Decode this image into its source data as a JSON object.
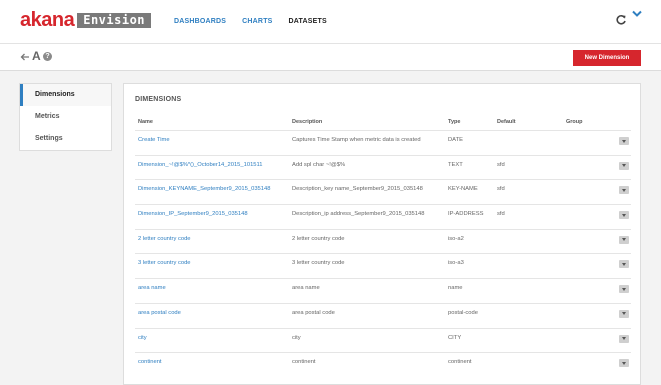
{
  "brand": {
    "logo_text": "akana",
    "product": "Envision",
    "accent": "#d6262d",
    "link": "#2f7fc1"
  },
  "nav": {
    "items": [
      "DASHBOARDS",
      "CHARTS",
      "DATASETS"
    ],
    "active": "DATASETS"
  },
  "toolbar": {
    "font_label": "A",
    "help_label": "?",
    "new_dimension_label": "New Dimension"
  },
  "sidebar": {
    "items": [
      "Dimensions",
      "Metrics",
      "Settings"
    ],
    "active": "Dimensions"
  },
  "dimensions": {
    "title": "DIMENSIONS",
    "columns": [
      "Name",
      "Description",
      "Type",
      "Default",
      "Group"
    ],
    "rows": [
      {
        "name": "Create Time",
        "description": "Captures Time Stamp when metric data is created",
        "type": "DATE",
        "default": ""
      },
      {
        "name": "Dimension_~!@$%*()_October14_2015_101511",
        "description": "Add spl char ~!@$%",
        "type": "TEXT",
        "default": "sfd"
      },
      {
        "name": "Dimension_KEYNAME_September9_2015_035148",
        "description": "Description_key name_September9_2015_035148",
        "type": "KEY-NAME",
        "default": "sfd"
      },
      {
        "name": "Dimension_IP_September9_2015_035148",
        "description": "Description_ip address_September9_2015_035148",
        "type": "IP-ADDRESS",
        "default": "sfd"
      },
      {
        "name": "2 letter country code",
        "description": "2 letter country code",
        "type": "iso-a2",
        "default": ""
      },
      {
        "name": "3 letter country code",
        "description": "3 letter country code",
        "type": "iso-a3",
        "default": ""
      },
      {
        "name": "area name",
        "description": "area name",
        "type": "name",
        "default": ""
      },
      {
        "name": "area postal code",
        "description": "area postal code",
        "type": "postal-code",
        "default": ""
      },
      {
        "name": "city",
        "description": "city",
        "type": "CITY",
        "default": ""
      },
      {
        "name": "continent",
        "description": "continent",
        "type": "continent",
        "default": ""
      }
    ]
  }
}
